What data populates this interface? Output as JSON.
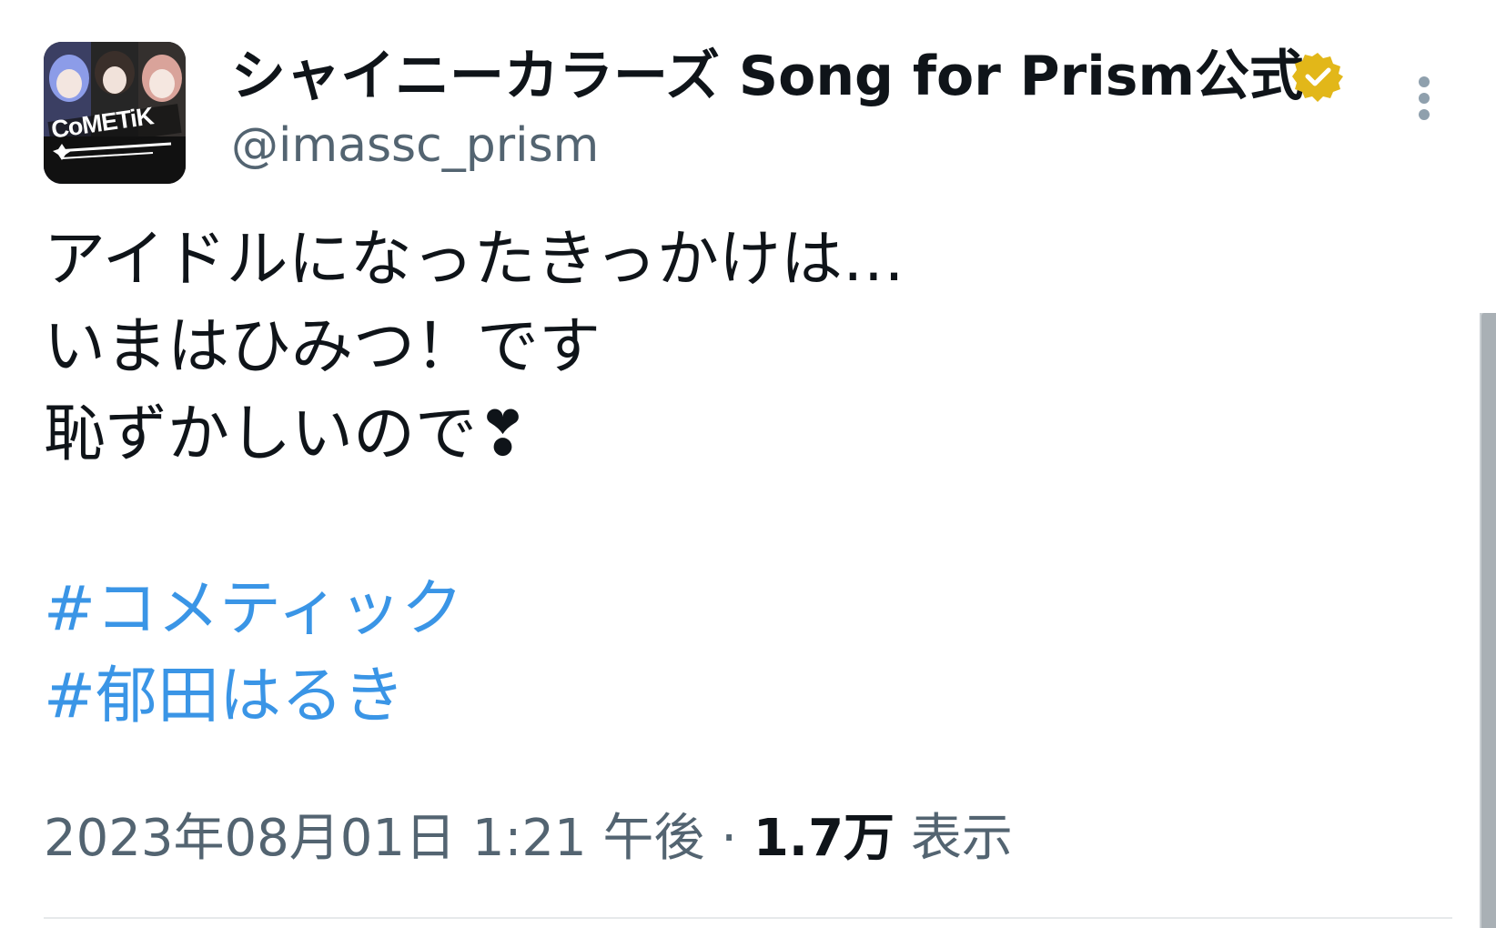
{
  "author": {
    "display_name": "シャイニーカラーズ Song for Prism公式",
    "handle": "@imassc_prism",
    "avatar_text": "CoMETiK",
    "verified": true,
    "verified_color": "#e2b719"
  },
  "tweet": {
    "lines": [
      "アイドルになったきっかけは…",
      "いまはひみつ！です",
      "恥ずかしいので❣"
    ],
    "hashtags": [
      "#コメティック",
      "#郁田はるき"
    ],
    "hashtag_color": "#3a95e6"
  },
  "meta": {
    "timestamp": "2023年08月01日 1:21 午後",
    "separator": "·",
    "views_count": "1.7万",
    "views_label": "表示"
  },
  "icons": {
    "more": "more-vertical-icon",
    "verified": "verified-badge-icon"
  }
}
